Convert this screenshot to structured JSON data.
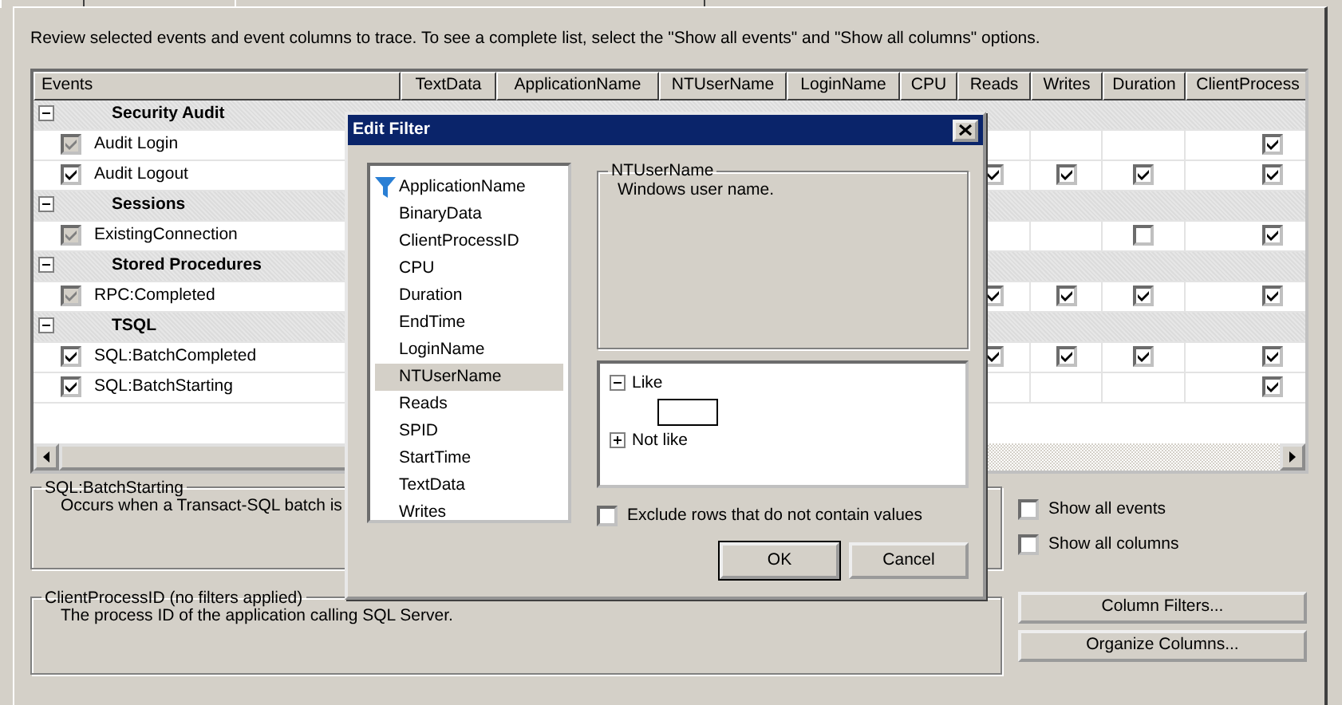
{
  "instructions": "Review selected events and event columns to trace. To see a complete list, select the \"Show all events\" and \"Show all columns\" options.",
  "grid": {
    "columns": [
      {
        "label": "Events"
      },
      {
        "label": "TextData"
      },
      {
        "label": "ApplicationName"
      },
      {
        "label": "NTUserName"
      },
      {
        "label": "LoginName"
      },
      {
        "label": "CPU"
      },
      {
        "label": "Reads"
      },
      {
        "label": "Writes"
      },
      {
        "label": "Duration"
      },
      {
        "label": "ClientProcess"
      }
    ],
    "rows": [
      {
        "kind": "category",
        "label": "Security Audit",
        "expanded": true
      },
      {
        "kind": "event",
        "label": "Audit Login",
        "checked": true,
        "disabled": true,
        "cells": [
          null,
          null,
          null,
          null,
          null,
          null,
          null,
          null,
          true
        ]
      },
      {
        "kind": "event",
        "label": "Audit Logout",
        "checked": true,
        "disabled": false,
        "cells": [
          null,
          null,
          null,
          null,
          null,
          true,
          true,
          true,
          true
        ]
      },
      {
        "kind": "category",
        "label": "Sessions",
        "expanded": true
      },
      {
        "kind": "event",
        "label": "ExistingConnection",
        "checked": true,
        "disabled": true,
        "cells": [
          null,
          null,
          null,
          null,
          null,
          null,
          null,
          false,
          true
        ]
      },
      {
        "kind": "category",
        "label": "Stored Procedures",
        "expanded": true
      },
      {
        "kind": "event",
        "label": "RPC:Completed",
        "checked": true,
        "disabled": true,
        "cells": [
          null,
          null,
          null,
          null,
          null,
          true,
          true,
          true,
          true
        ]
      },
      {
        "kind": "category",
        "label": "TSQL",
        "expanded": true
      },
      {
        "kind": "event",
        "label": "SQL:BatchCompleted",
        "checked": true,
        "disabled": false,
        "cells": [
          null,
          null,
          null,
          null,
          null,
          true,
          true,
          true,
          true
        ]
      },
      {
        "kind": "event",
        "label": "SQL:BatchStarting",
        "checked": true,
        "disabled": false,
        "cells": [
          null,
          null,
          null,
          null,
          null,
          null,
          null,
          null,
          true
        ]
      }
    ]
  },
  "event_description": {
    "title": "SQL:BatchStarting",
    "text": "Occurs when a Transact-SQL batch is"
  },
  "options": [
    {
      "label": "Show all events",
      "checked": false
    },
    {
      "label": "Show all columns",
      "checked": false
    }
  ],
  "column_description": {
    "title": "ClientProcessID (no filters applied)",
    "text": "The process ID of the application calling SQL Server."
  },
  "buttons": [
    "Column Filters...",
    "Organize Columns..."
  ],
  "dialog": {
    "title": "Edit Filter",
    "columns": [
      {
        "label": "ApplicationName",
        "filtered": true,
        "selected": false
      },
      {
        "label": "BinaryData",
        "filtered": false,
        "selected": false
      },
      {
        "label": "ClientProcessID",
        "filtered": false,
        "selected": false
      },
      {
        "label": "CPU",
        "filtered": false,
        "selected": false
      },
      {
        "label": "Duration",
        "filtered": false,
        "selected": false
      },
      {
        "label": "EndTime",
        "filtered": false,
        "selected": false
      },
      {
        "label": "LoginName",
        "filtered": false,
        "selected": false
      },
      {
        "label": "NTUserName",
        "filtered": false,
        "selected": true
      },
      {
        "label": "Reads",
        "filtered": false,
        "selected": false
      },
      {
        "label": "SPID",
        "filtered": false,
        "selected": false
      },
      {
        "label": "StartTime",
        "filtered": false,
        "selected": false
      },
      {
        "label": "TextData",
        "filtered": false,
        "selected": false
      },
      {
        "label": "Writes",
        "filtered": false,
        "selected": false
      }
    ],
    "description": {
      "title": "NTUserName",
      "text": "Windows user name."
    },
    "operators": [
      {
        "label": "Like",
        "expanded": true
      },
      {
        "label": "Not like",
        "expanded": false
      }
    ],
    "exclude": {
      "label": "Exclude rows that do not contain values",
      "checked": false
    },
    "buttons": [
      {
        "label": "OK",
        "default": true
      },
      {
        "label": "Cancel",
        "default": false
      }
    ]
  }
}
